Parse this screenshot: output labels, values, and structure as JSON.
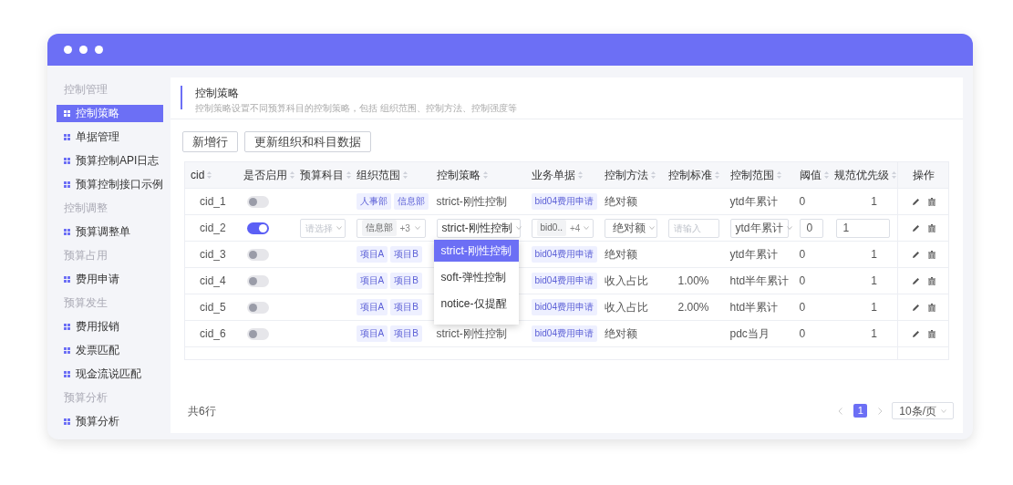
{
  "sidebar": {
    "groups": [
      {
        "label": "控制管理",
        "items": [
          {
            "label": "控制策略",
            "selected": true
          },
          {
            "label": "单据管理",
            "selected": false
          },
          {
            "label": "预算控制API日志",
            "selected": false
          },
          {
            "label": "预算控制接口示例",
            "selected": false
          }
        ]
      },
      {
        "label": "控制调整",
        "items": [
          {
            "label": "预算调整单",
            "selected": false
          }
        ]
      },
      {
        "label": "预算占用",
        "items": [
          {
            "label": "费用申请",
            "selected": false
          }
        ]
      },
      {
        "label": "预算发生",
        "items": [
          {
            "label": "费用报销",
            "selected": false
          },
          {
            "label": "发票匹配",
            "selected": false
          },
          {
            "label": "现金流说匹配",
            "selected": false
          }
        ]
      },
      {
        "label": "预算分析",
        "items": [
          {
            "label": "预算分析",
            "selected": false
          }
        ]
      }
    ]
  },
  "page": {
    "title": "控制策略",
    "subtitle": "控制策略设置不同预算科目的控制策略，包括 组织范围、控制方法、控制强度等"
  },
  "toolbar": [
    "新增行",
    "更新组织和科目数据"
  ],
  "table": {
    "columns": [
      {
        "label": "cid",
        "sortable": true
      },
      {
        "label": "是否启用",
        "sortable": true
      },
      {
        "label": "预算科目",
        "sortable": true
      },
      {
        "label": "组织范围",
        "sortable": true
      },
      {
        "label": "控制策略",
        "sortable": true
      },
      {
        "label": "业务单据",
        "sortable": true
      },
      {
        "label": "控制方法",
        "sortable": true
      },
      {
        "label": "控制标准",
        "sortable": true
      },
      {
        "label": "控制范围",
        "sortable": true
      },
      {
        "label": "阈值",
        "sortable": true
      },
      {
        "label": "规范优先级",
        "sortable": true
      },
      {
        "label": "操作",
        "sortable": false
      }
    ],
    "rows": [
      {
        "kind": "view",
        "cid": "cid_1",
        "enabled": false,
        "org_tags": [
          "人事部",
          "信息部"
        ],
        "strategy": "strict-刚性控制",
        "bill_tags": [
          "bid04费用申请"
        ],
        "method": "绝对额",
        "standard": "",
        "scope": "ytd年累计",
        "threshold": "0",
        "priority": "1"
      },
      {
        "kind": "edit",
        "cid": "cid_2",
        "enabled": true,
        "subject": {
          "placeholder": "请选择"
        },
        "org": {
          "tags": [
            "信息部"
          ],
          "more": "+3"
        },
        "strategy": {
          "value": "strict-刚性控制",
          "options": [
            {
              "label": "strict-刚性控制",
              "selected": true
            },
            {
              "label": "soft-弹性控制",
              "selected": false
            },
            {
              "label": "notice-仅提醒",
              "selected": false
            }
          ]
        },
        "bill": {
          "tags": [
            "bid0.."
          ],
          "more": "+4"
        },
        "method": {
          "value": "绝对额"
        },
        "standard": {
          "placeholder": "请输入"
        },
        "scope": {
          "value": "ytd年累计"
        },
        "threshold": {
          "value": "0"
        },
        "priority": {
          "value": "1"
        }
      },
      {
        "kind": "view",
        "cid": "cid_3",
        "enabled": false,
        "org_tags": [
          "项目A",
          "项目B"
        ],
        "bill_tags": [
          "bid04费用申请"
        ],
        "method": "绝对额",
        "standard": "",
        "scope": "ytd年累计",
        "threshold": "0",
        "priority": "1"
      },
      {
        "kind": "view",
        "cid": "cid_4",
        "enabled": false,
        "org_tags": [
          "项目A",
          "项目B"
        ],
        "bill_tags": [
          "bid04费用申请"
        ],
        "method": "收入占比",
        "standard": "1.00%",
        "scope": "htd半年累计",
        "threshold": "0",
        "priority": "1"
      },
      {
        "kind": "view",
        "cid": "cid_5",
        "enabled": false,
        "org_tags": [
          "项目A",
          "项目B"
        ],
        "bill_tags": [
          "bid04费用申请"
        ],
        "method": "收入占比",
        "standard": "2.00%",
        "scope": "htd半累计",
        "threshold": "0",
        "priority": "1"
      },
      {
        "kind": "view",
        "cid": "cid_6",
        "enabled": false,
        "org_tags": [
          "项目A",
          "项目B"
        ],
        "strategy": "strict-刚性控制",
        "bill_tags": [
          "bid04费用申请"
        ],
        "method": "绝对额",
        "standard": "",
        "scope": "pdc当月",
        "threshold": "0",
        "priority": "1"
      }
    ]
  },
  "footer": {
    "total": "共6行",
    "pages": [
      {
        "label": "1",
        "selected": true
      }
    ],
    "page_size": "10条/页"
  }
}
